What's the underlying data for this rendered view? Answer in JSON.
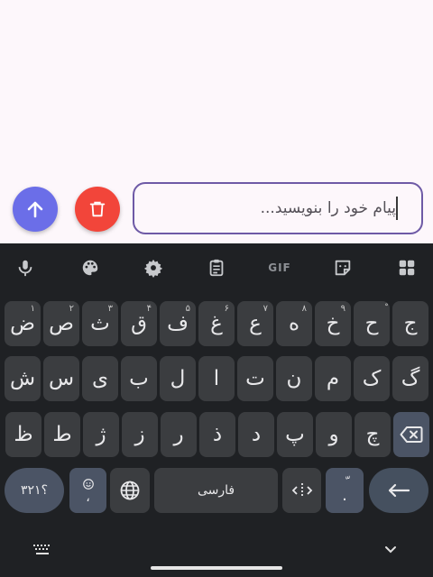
{
  "composer": {
    "placeholder": "پیام خود را بنویسید...",
    "send_color": "#6b6ee8",
    "delete_color": "#f2453a"
  },
  "toolbar": {
    "icons": [
      "mic-icon",
      "palette-icon",
      "gear-icon",
      "clipboard-icon",
      "gif-icon",
      "sticker-icon",
      "apps-grid-icon"
    ],
    "gif_label": "GIF"
  },
  "keyboard": {
    "row1": [
      {
        "label": "ج",
        "hint": ""
      },
      {
        "label": "ح",
        "hint": "ْ"
      },
      {
        "label": "خ",
        "hint": "۹"
      },
      {
        "label": "ه",
        "hint": "۸"
      },
      {
        "label": "ع",
        "hint": "۷"
      },
      {
        "label": "غ",
        "hint": "۶"
      },
      {
        "label": "ف",
        "hint": "۵"
      },
      {
        "label": "ق",
        "hint": "۴"
      },
      {
        "label": "ث",
        "hint": "۳"
      },
      {
        "label": "ص",
        "hint": "۲"
      },
      {
        "label": "ض",
        "hint": "۱"
      }
    ],
    "row2": [
      "گ",
      "ک",
      "م",
      "ن",
      "ت",
      "ا",
      "ل",
      "ب",
      "ی",
      "س",
      "ش"
    ],
    "row3": [
      "چ",
      "و",
      "پ",
      "د",
      "ذ",
      "ر",
      "ز",
      "ژ",
      "ط",
      "ظ"
    ],
    "symbols_label": "؟۳۲۱",
    "emoji_comma_label": "،",
    "space_label": "فارسی",
    "period_label": ".",
    "period_hint": "ّ"
  }
}
